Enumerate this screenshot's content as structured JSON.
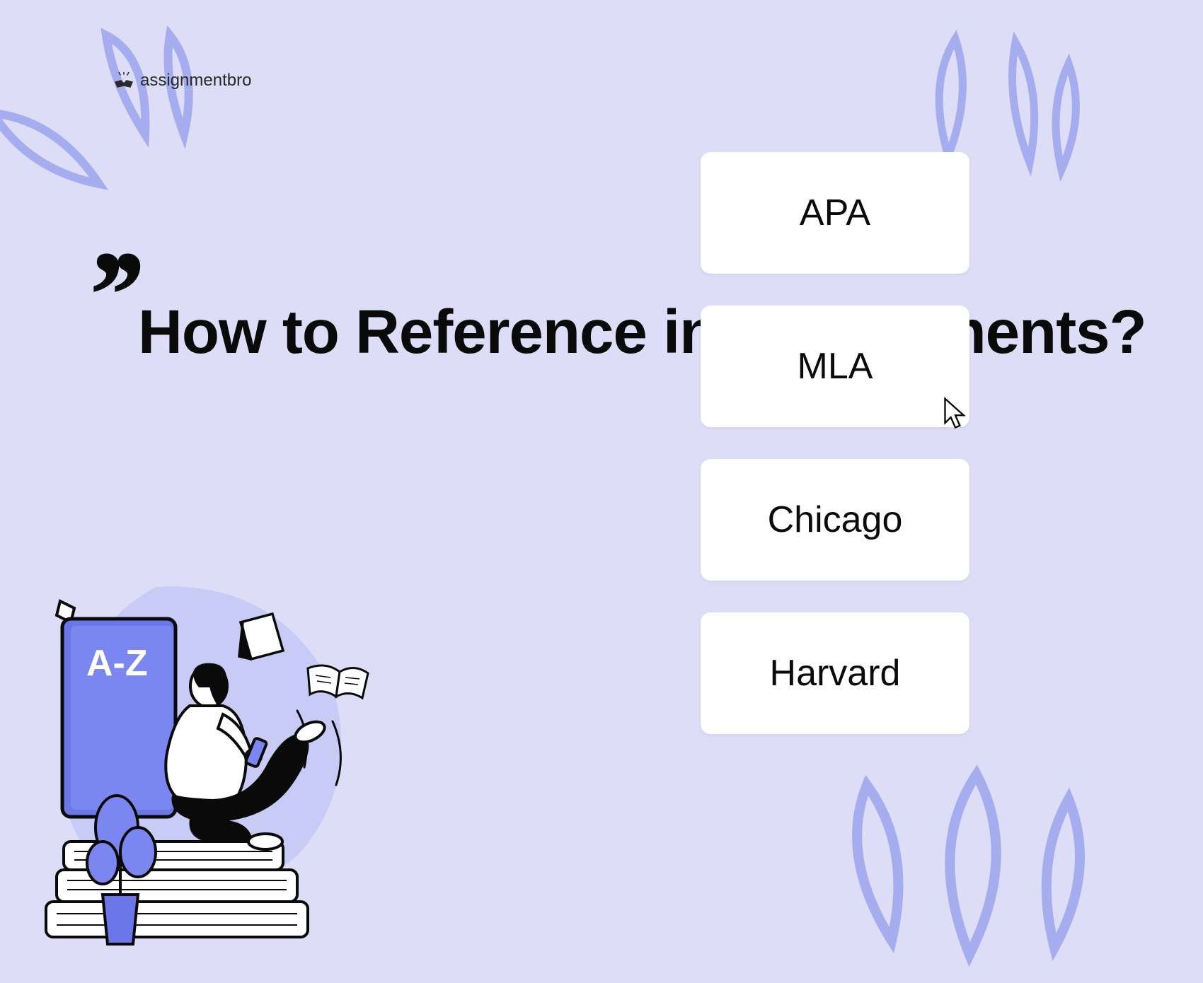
{
  "brand": {
    "name": "assignmentbro"
  },
  "heading": "How to Reference in Assignments?",
  "illustration": {
    "book_label": "A-Z"
  },
  "options": [
    {
      "label": "APA"
    },
    {
      "label": "MLA"
    },
    {
      "label": "Chicago"
    },
    {
      "label": "Harvard"
    }
  ],
  "colors": {
    "background": "#DDDDF7",
    "accent": "#7B86F0",
    "text": "#0a0a0a",
    "card": "#ffffff"
  }
}
